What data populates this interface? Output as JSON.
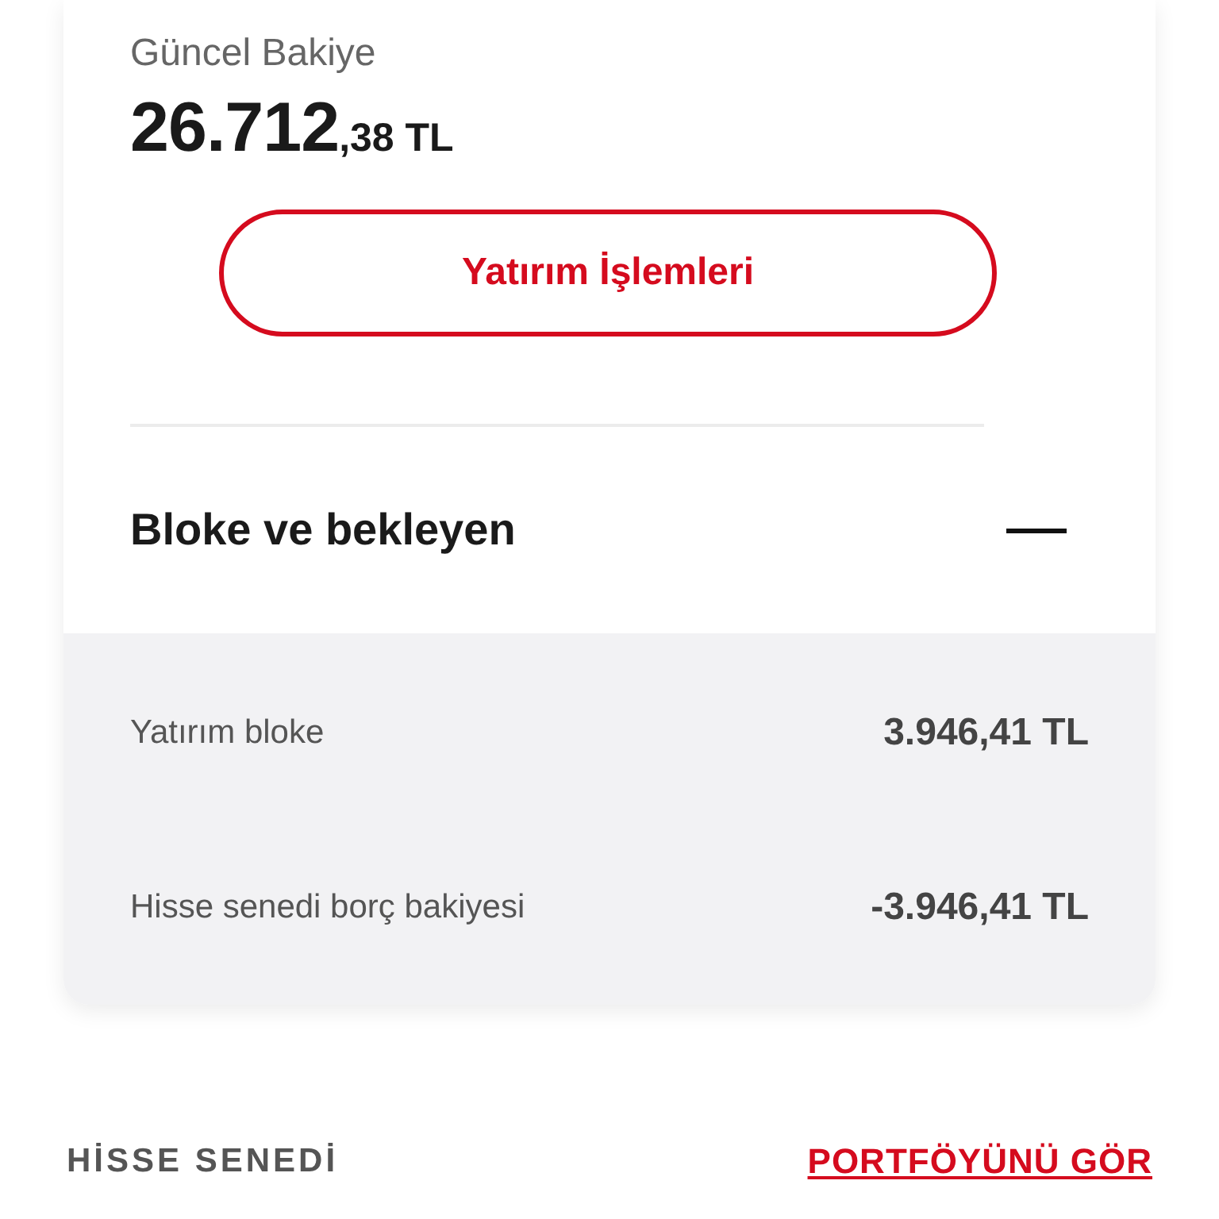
{
  "balance_card": {
    "label": "Güncel Bakiye",
    "amount_integer": "26.712",
    "amount_decimal": ",38 TL",
    "action_button": "Yatırım İşlemleri"
  },
  "blocked_section": {
    "title": "Bloke ve bekleyen",
    "expanded": true,
    "rows": [
      {
        "label": "Yatırım bloke",
        "value": "3.946,41 TL"
      },
      {
        "label": "Hisse senedi borç bakiyesi",
        "value": "-3.946,41 TL"
      }
    ]
  },
  "stocks_header": {
    "title": "HİSSE SENEDİ",
    "link": "PORTFÖYÜNÜ GÖR"
  }
}
